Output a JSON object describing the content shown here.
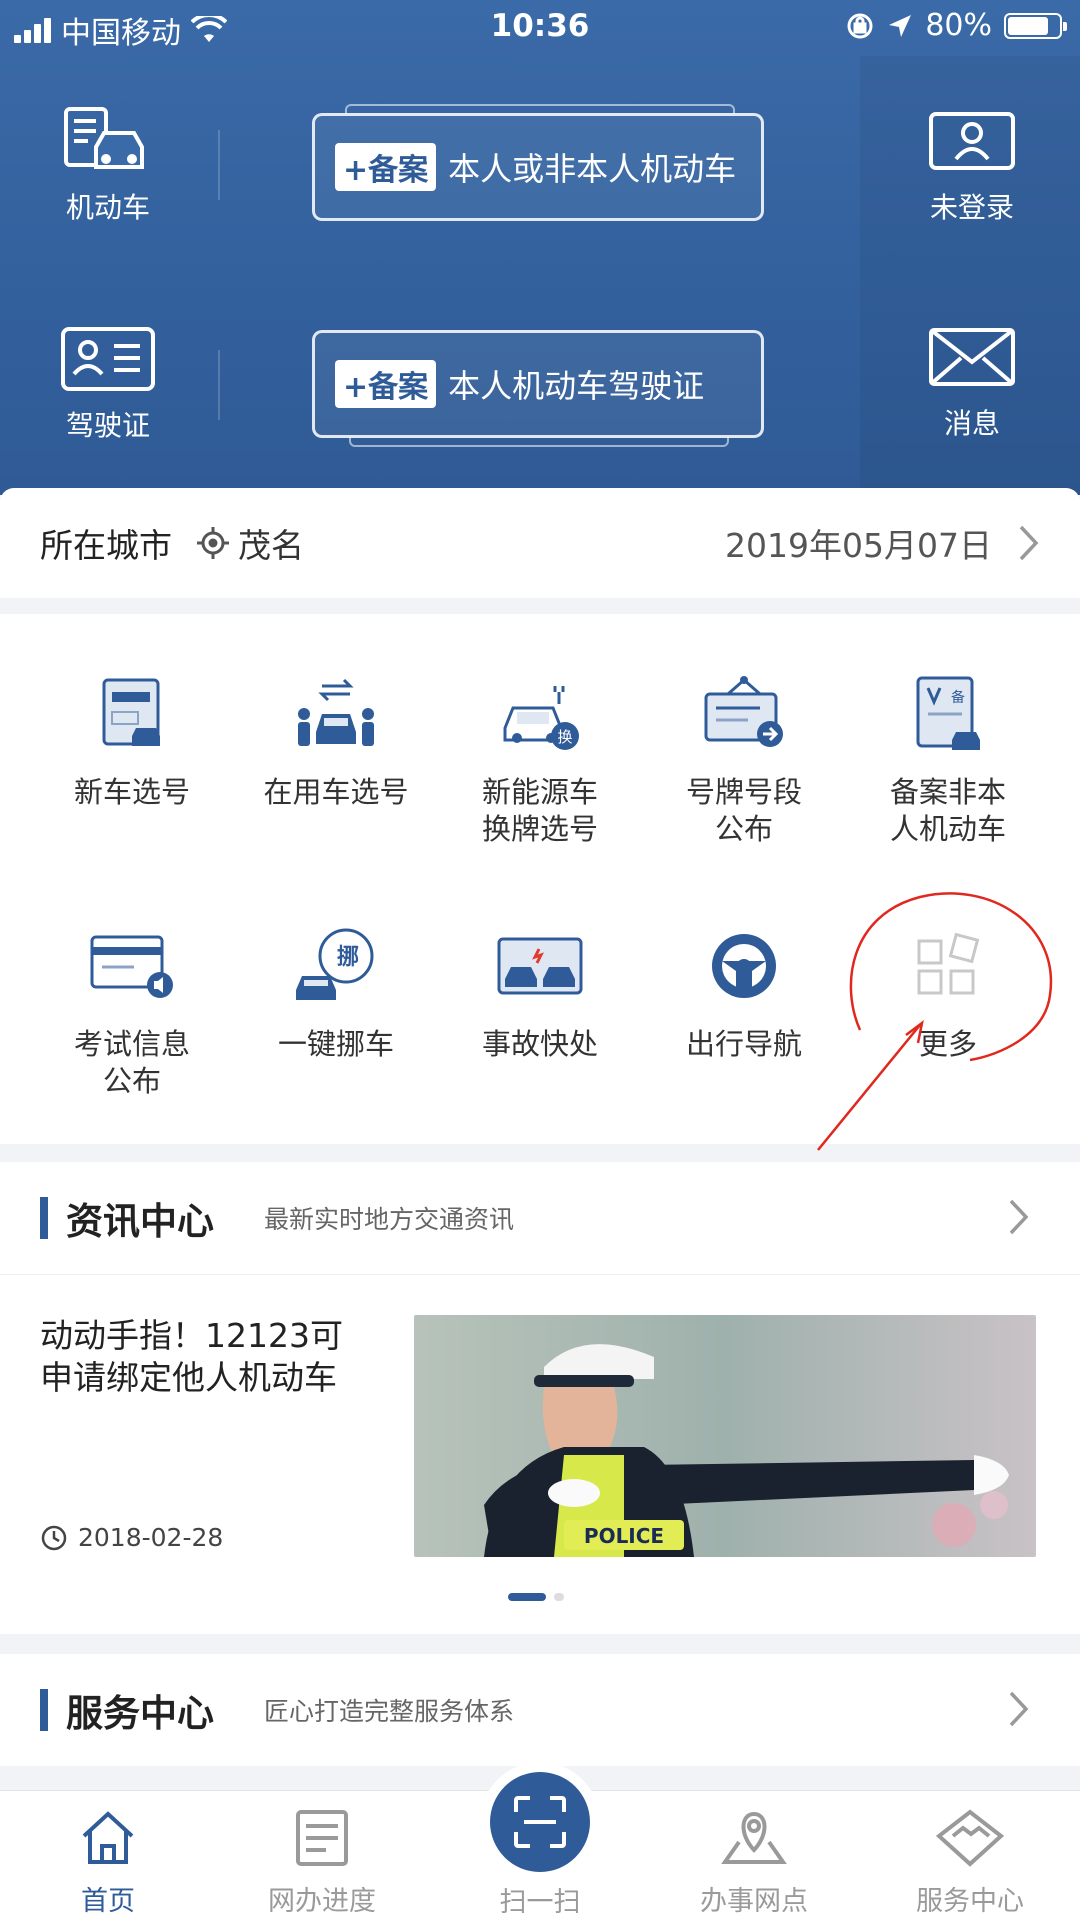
{
  "status_bar": {
    "carrier": "中国移动",
    "time": "10:36",
    "battery": "80%",
    "battery_level": 0.8
  },
  "header": {
    "vehicle_label": "机动车",
    "license_label": "驾驶证",
    "login_label": "未登录",
    "message_label": "消息",
    "plate1": {
      "tag": "+备案",
      "text": "本人或非本人机动车"
    },
    "plate2": {
      "tag": "+备案",
      "text": "本人机动车驾驶证"
    }
  },
  "city": {
    "label": "所在城市",
    "name": "茂名",
    "date": "2019年05月07日"
  },
  "services": [
    {
      "label": "新车选号",
      "icon": "new-car-plate-icon"
    },
    {
      "label": "在用车选号",
      "icon": "used-car-plate-icon"
    },
    {
      "label": "新能源车\n换牌选号",
      "icon": "new-energy-car-icon"
    },
    {
      "label": "号牌号段\n公布",
      "icon": "plate-announcement-icon"
    },
    {
      "label": "备案非本\n人机动车",
      "icon": "register-vehicle-icon"
    },
    {
      "label": "考试信息\n公布",
      "icon": "exam-info-icon"
    },
    {
      "label": "一键挪车",
      "icon": "move-car-icon"
    },
    {
      "label": "事故快处",
      "icon": "accident-icon"
    },
    {
      "label": "出行导航",
      "icon": "steering-wheel-icon"
    },
    {
      "label": "更多",
      "icon": "more-icon"
    }
  ],
  "news": {
    "title": "资讯中心",
    "subtitle": "最新实时地方交通资讯",
    "item_title": "动动手指！12123可申请绑定他人机动车",
    "item_date": "2018-02-28",
    "image_text": "POLICE"
  },
  "service_center": {
    "title": "服务中心",
    "subtitle": "匠心打造完整服务体系"
  },
  "bottom_nav": [
    {
      "label": "首页"
    },
    {
      "label": "网办进度"
    },
    {
      "label": "扫一扫"
    },
    {
      "label": "办事网点"
    },
    {
      "label": "服务中心"
    }
  ],
  "colors": {
    "primary": "#2f5c98",
    "header": "#3b6aa8",
    "annotation": "#e0281e"
  }
}
